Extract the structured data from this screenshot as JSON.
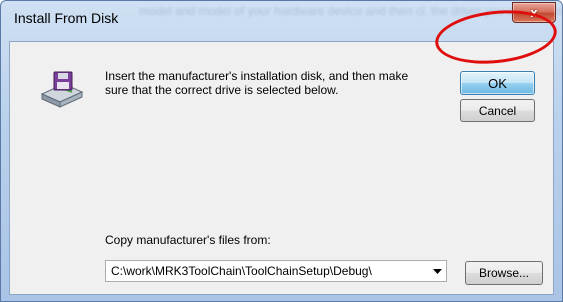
{
  "window": {
    "title": "Install From Disk",
    "close_label": "x",
    "background_text": "model and model of your hardware device and then cl. the driver you want to install, click Have Disk."
  },
  "dialog": {
    "message": "Insert the manufacturer's installation disk, and then make sure that the correct drive is selected below.",
    "ok_label": "OK",
    "cancel_label": "Cancel",
    "copy_label": "Copy manufacturer's files from:",
    "path_value": "C:\\work\\MRK3ToolChain\\ToolChainSetup\\Debug\\",
    "browse_label": "Browse..."
  },
  "icons": {
    "disk": "disk-drive-icon",
    "dropdown": "chevron-down-icon"
  },
  "colors": {
    "annotation_circle": "#e00d0d",
    "title_bar": "#b9d1ec",
    "close_button": "#c24a33",
    "dialog_background": "#f0f0f0"
  }
}
